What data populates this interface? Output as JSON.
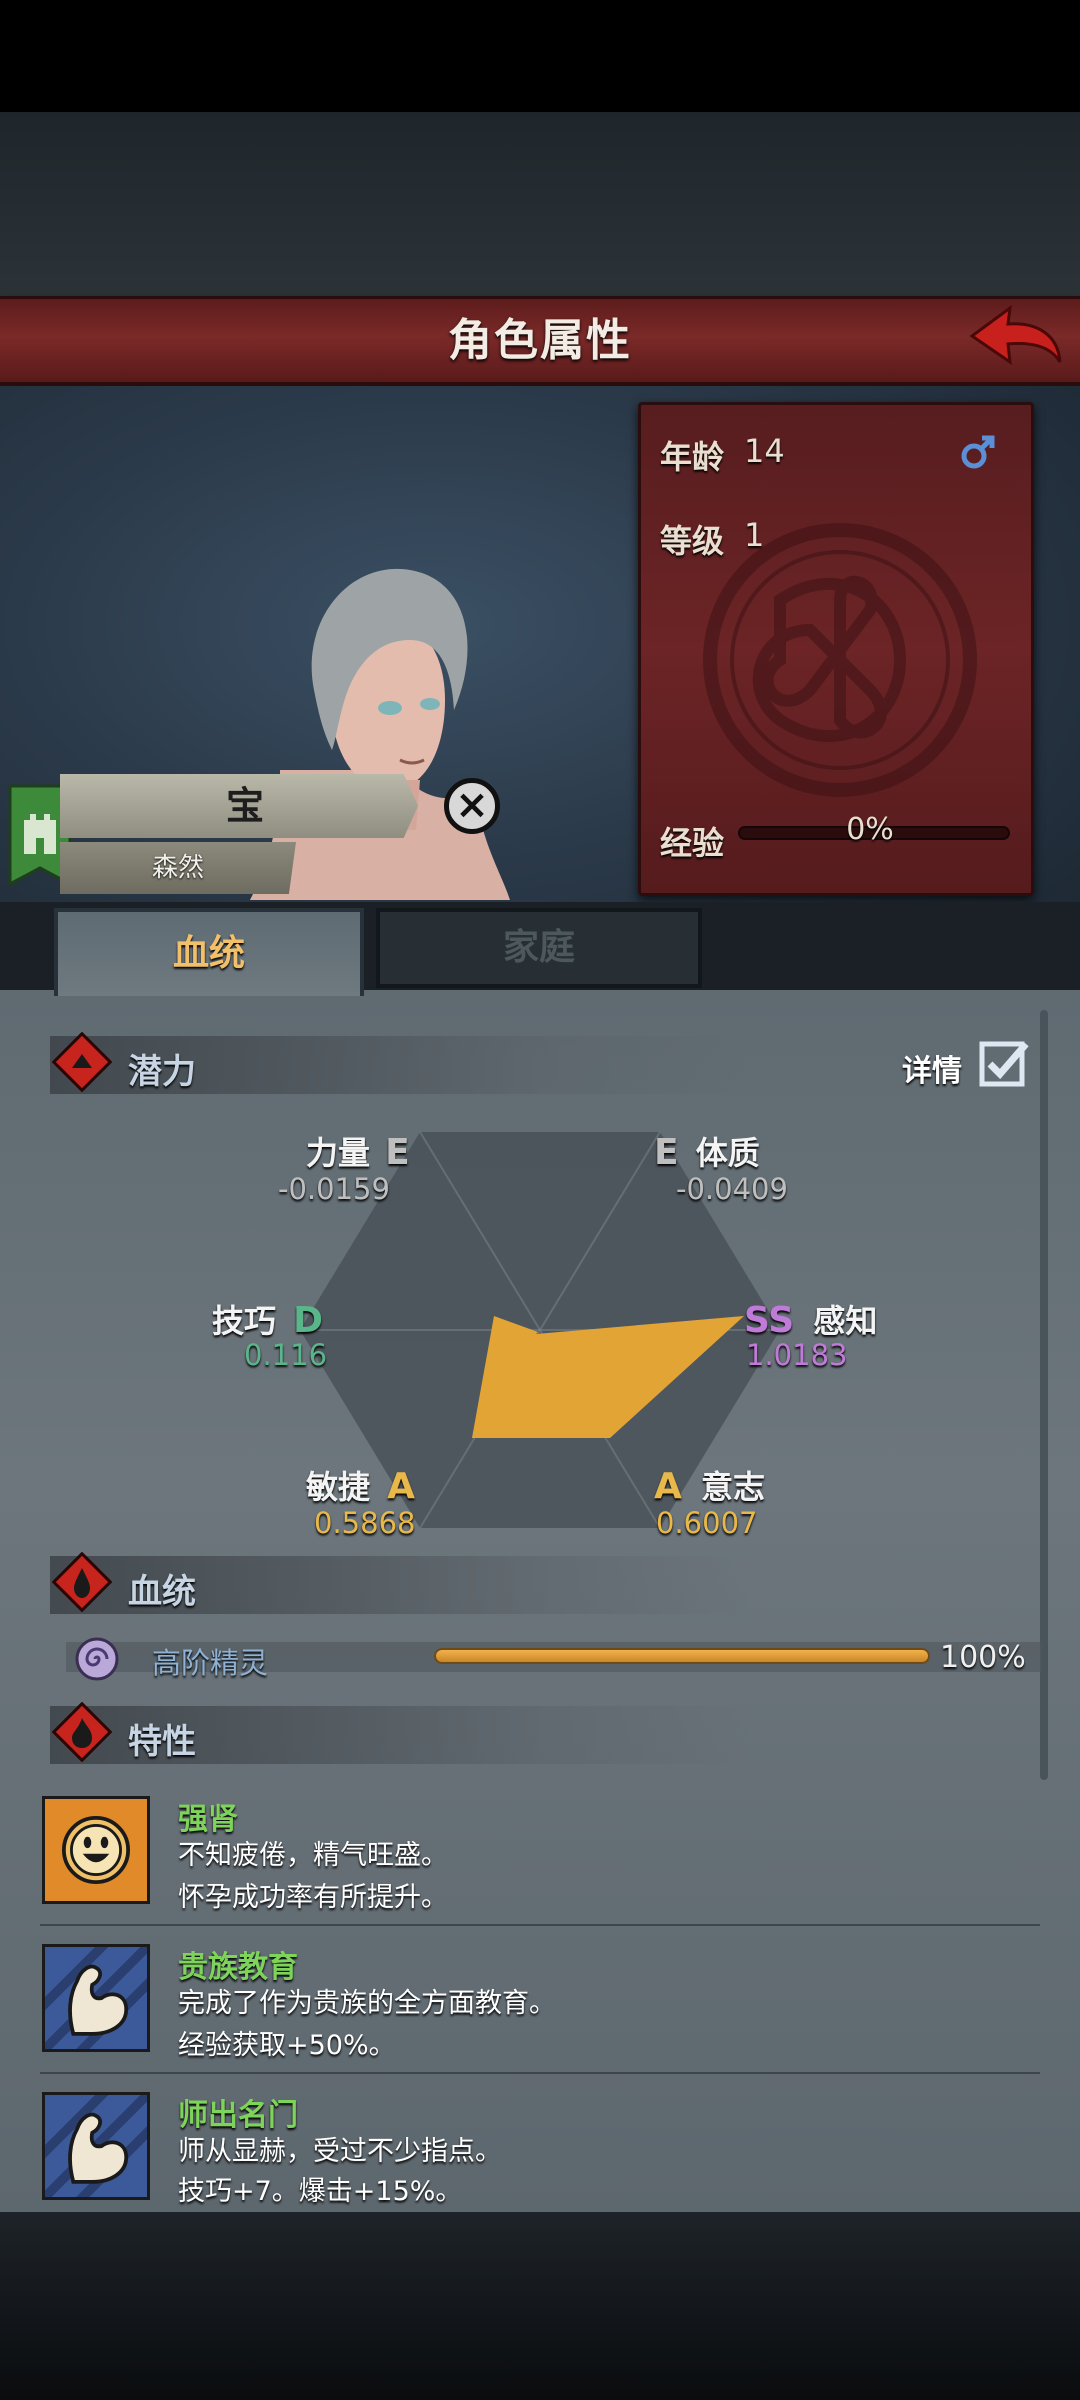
{
  "header": {
    "title": "角色属性",
    "back_icon": "back-arrow-icon"
  },
  "info": {
    "age_label": "年龄",
    "age_value": "14",
    "level_label": "等级",
    "level_value": "1",
    "exp_label": "经验",
    "exp_value": "0%",
    "exp_fraction": 0,
    "gender_icon": "male-icon"
  },
  "character": {
    "name": "宝",
    "subtitle": "森然"
  },
  "tabs": [
    {
      "label": "血统",
      "active": true
    },
    {
      "label": "家庭",
      "active": false
    }
  ],
  "potential": {
    "title": "潜力",
    "detail_label": "详情",
    "detail_checked": true,
    "stats": [
      {
        "name": "力量",
        "grade": "E",
        "value": "-0.0159",
        "color": "#bfbfbf"
      },
      {
        "name": "体质",
        "grade": "E",
        "value": "-0.0409",
        "color": "#bfbfbf"
      },
      {
        "name": "感知",
        "grade": "SS",
        "value": "1.0183",
        "color": "#c07ad8"
      },
      {
        "name": "意志",
        "grade": "A",
        "value": "0.6007",
        "color": "#e8b84a"
      },
      {
        "name": "敏捷",
        "grade": "A",
        "value": "0.5868",
        "color": "#e8b84a"
      },
      {
        "name": "技巧",
        "grade": "D",
        "value": "0.116",
        "color": "#5bb58a"
      }
    ]
  },
  "bloodline": {
    "title": "血统",
    "items": [
      {
        "name": "高阶精灵",
        "percent": "100%",
        "fraction": 1.0
      }
    ]
  },
  "traits": {
    "title": "特性",
    "items": [
      {
        "name": "强肾",
        "line1": "不知疲倦，精气旺盛。",
        "line2": "怀孕成功率有所提升。",
        "icon": "smiley-sun-icon"
      },
      {
        "name": "贵族教育",
        "line1": "完成了作为贵族的全方面教育。",
        "line2": "经验获取+50%。",
        "icon": "flexed-arm-icon"
      },
      {
        "name": "师出名门",
        "line1": "师从显赫，受过不少指点。",
        "line2": "技巧+7。爆击+15%。",
        "icon": "flexed-arm-icon"
      }
    ]
  },
  "colors": {
    "accent_red": "#6c2426",
    "radar_fill": "#e3a436",
    "trait_green": "#7ed35a"
  }
}
